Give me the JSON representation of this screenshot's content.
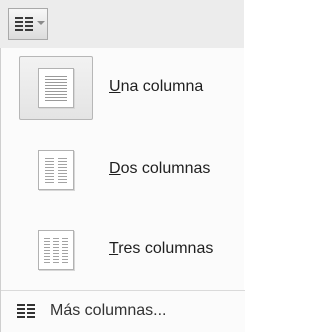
{
  "toolbar": {
    "button_icon": "columns-icon",
    "dropdown_icon": "chevron-down-icon"
  },
  "menu": {
    "items": [
      {
        "mnemonic": "U",
        "rest": "na columna",
        "icon": "one-column-icon",
        "selected": true
      },
      {
        "mnemonic": "D",
        "rest": "os columnas",
        "icon": "two-columns-icon",
        "selected": false
      },
      {
        "mnemonic": "T",
        "rest": "res columnas",
        "icon": "three-columns-icon",
        "selected": false
      }
    ],
    "more": {
      "label": "Más columnas...",
      "icon": "columns-icon"
    }
  },
  "colors": {
    "toolbar_bg": "#ececec",
    "menu_bg": "#fbfbfb",
    "selected_bg": "#e8e8e8",
    "text": "#1f1f1f"
  }
}
